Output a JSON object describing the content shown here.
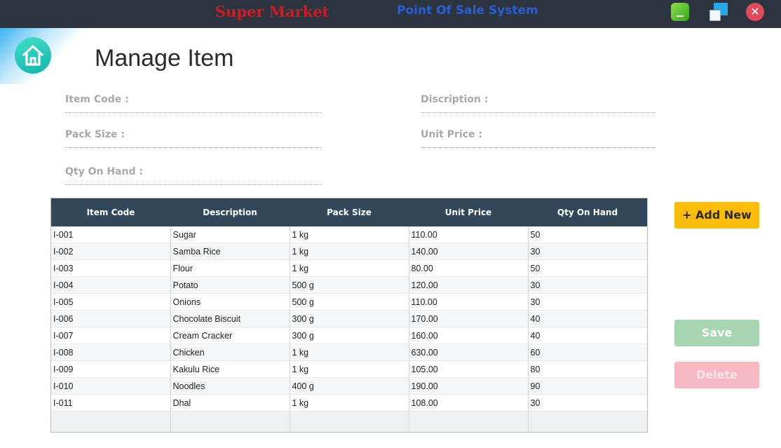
{
  "window": {
    "brand_left": "Super Market",
    "brand_right": "Point Of Sale System",
    "minimize_icon": "minimize-icon",
    "maximize_icon": "maximize-icon",
    "close_icon": "close-icon",
    "close_glyph": "✕"
  },
  "page": {
    "home_icon": "home-icon",
    "title": "Manage Item"
  },
  "form": {
    "item_code_label": "Item Code :",
    "description_label": "Discription :",
    "pack_size_label": "Pack Size :",
    "unit_price_label": "Unit Price :",
    "qty_on_hand_label": "Qty On Hand :",
    "item_code_value": "",
    "description_value": "",
    "pack_size_value": "",
    "unit_price_value": "",
    "qty_on_hand_value": ""
  },
  "table": {
    "headers": [
      "Item Code",
      "Description",
      "Pack Size",
      "Unit Price",
      "Qty On Hand"
    ],
    "rows": [
      [
        "I-001",
        "Sugar",
        "1 kg",
        "110.00",
        "50"
      ],
      [
        "I-002",
        "Samba Rice",
        "1 kg",
        "140.00",
        "30"
      ],
      [
        "I-003",
        "Flour",
        "1 kg",
        "80.00",
        "50"
      ],
      [
        "I-004",
        "Potato",
        "500 g",
        "120.00",
        "30"
      ],
      [
        "I-005",
        "Onions",
        "500 g",
        "110.00",
        "30"
      ],
      [
        "I-006",
        "Chocolate Biscuit",
        "300 g",
        "170.00",
        "40"
      ],
      [
        "I-007",
        "Cream Cracker",
        "300 g",
        "160.00",
        "40"
      ],
      [
        "I-008",
        "Chicken",
        "1 kg",
        "630.00",
        "60"
      ],
      [
        "I-009",
        "Kakulu Rice",
        "1 kg",
        "105.00",
        "80"
      ],
      [
        "I-010",
        "Noodles",
        "400 g",
        "190.00",
        "90"
      ],
      [
        "I-011",
        "Dhal",
        "1 kg",
        "108.00",
        "30"
      ]
    ]
  },
  "buttons": {
    "add_new": "+ Add New",
    "save": "Save",
    "delete": "Delete"
  },
  "colors": {
    "topbar": "#2c3440",
    "brand_left": "#d21a22",
    "brand_right": "#2a5fd4",
    "table_header": "#33475b",
    "add_button": "#f9bc0b",
    "save_button": "#a8d5b1",
    "delete_button": "#f6b9c2"
  }
}
